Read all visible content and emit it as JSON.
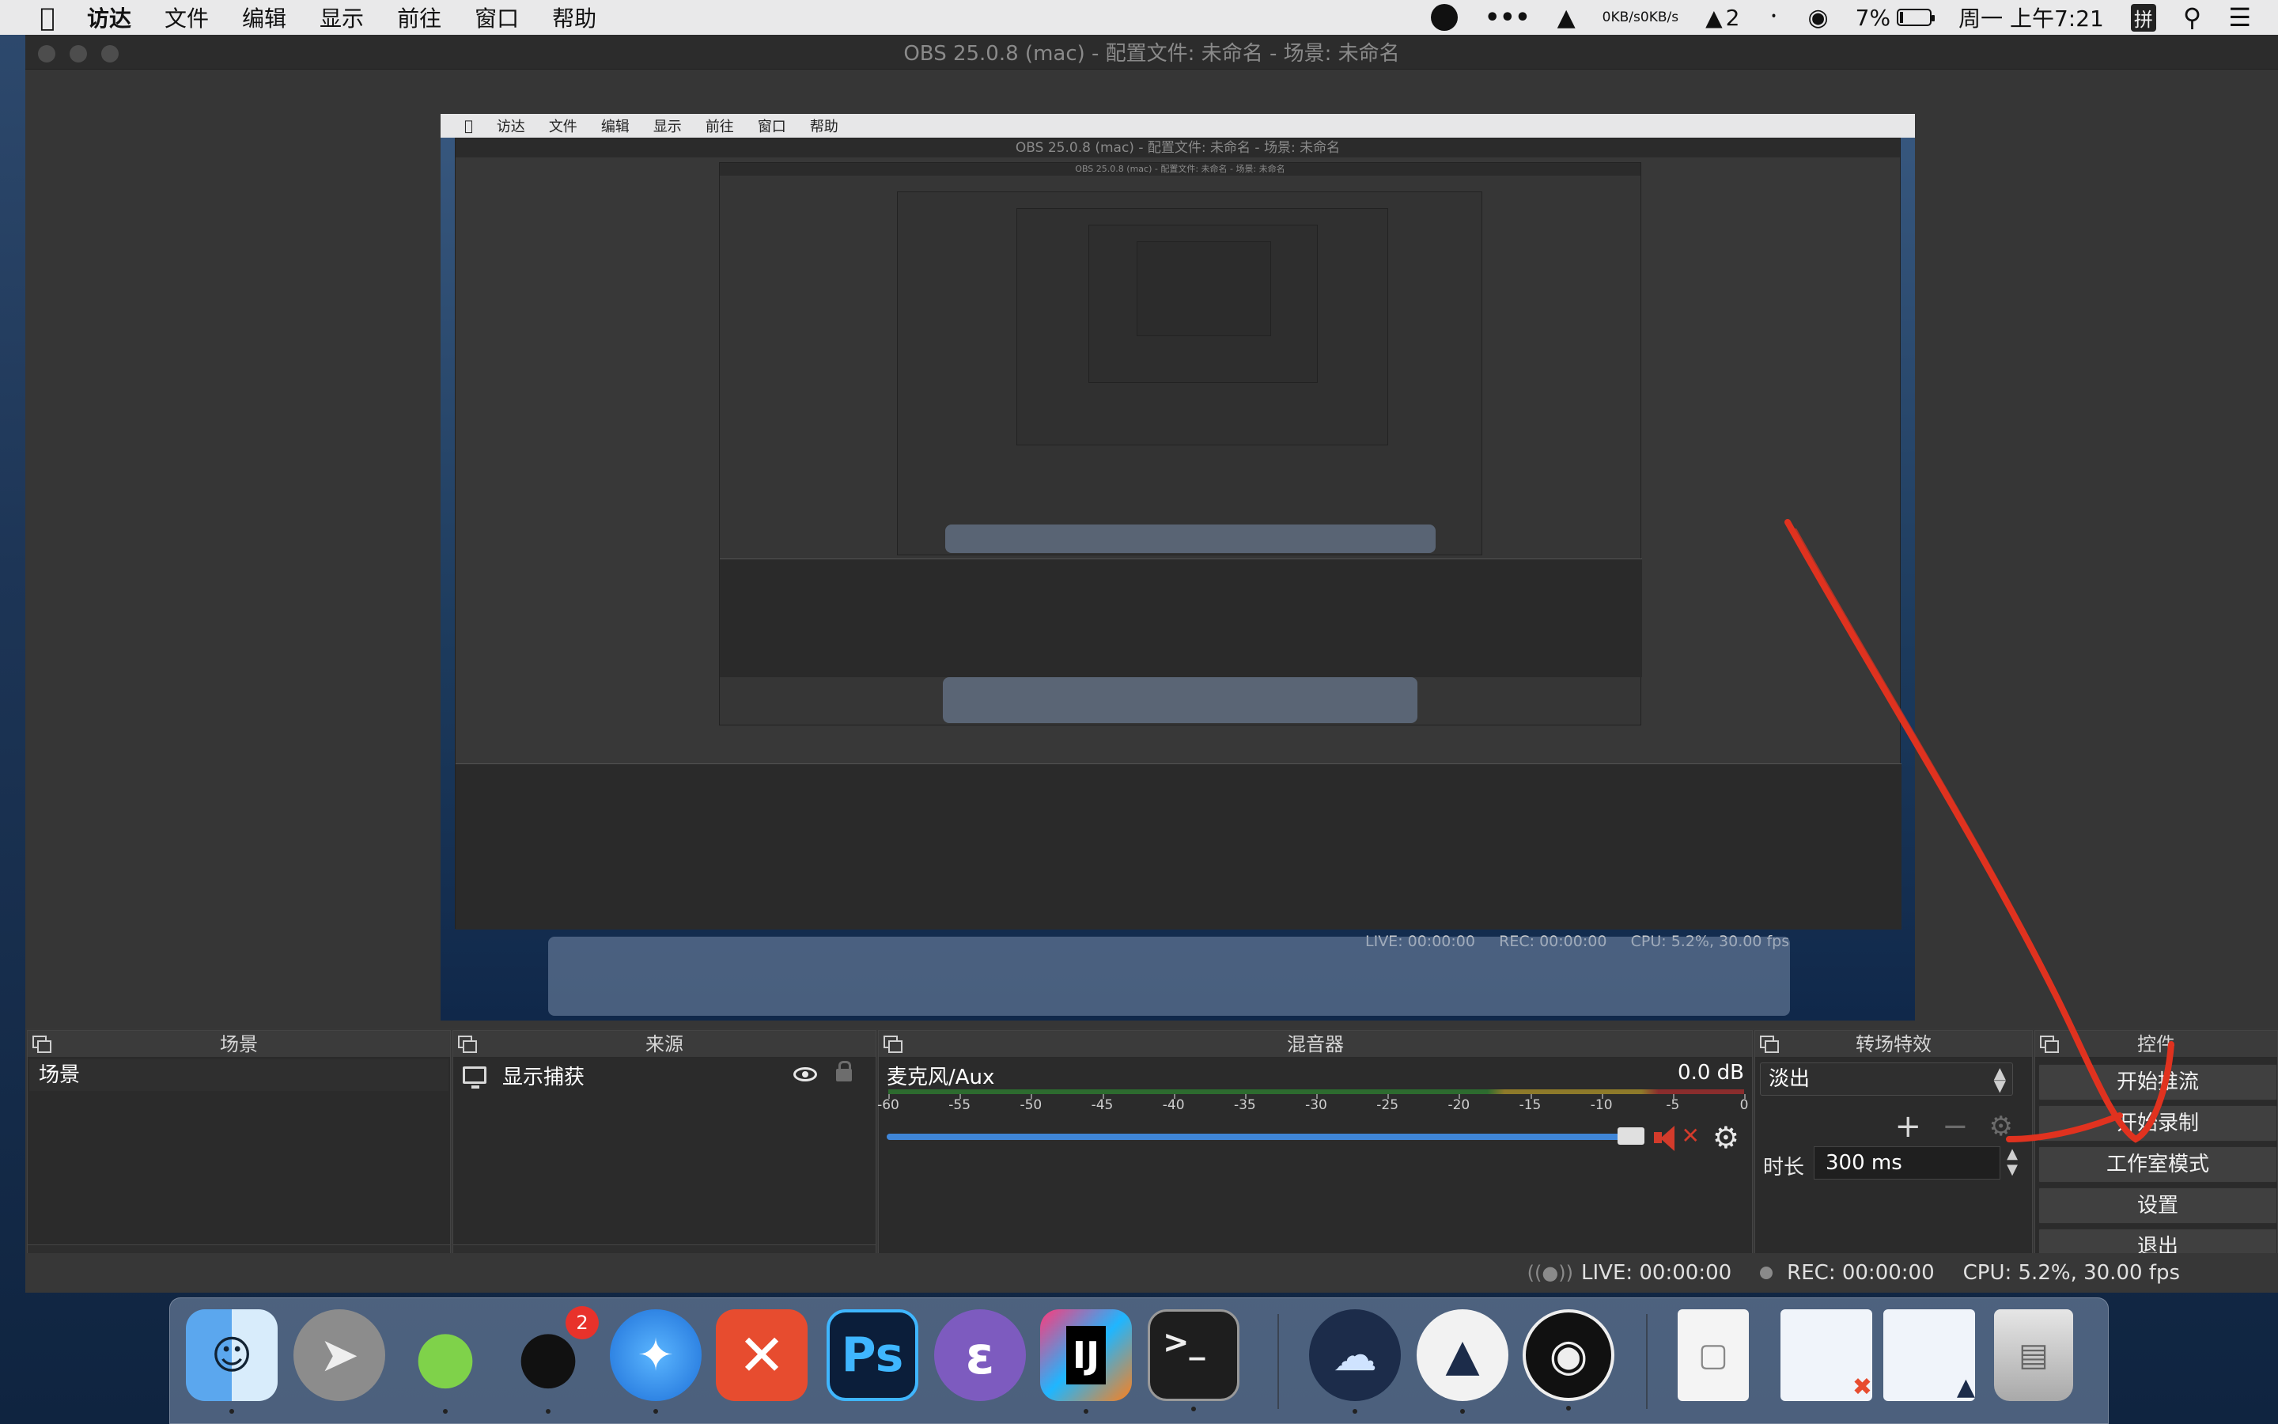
{
  "menubar": {
    "app_name": "访达",
    "items": [
      "文件",
      "编辑",
      "显示",
      "前往",
      "窗口",
      "帮助"
    ],
    "net_up": "0KB/s",
    "net_down": "0KB/s",
    "qq_count": "2",
    "battery": "7%",
    "datetime": "周一 上午7:21",
    "input_method": "拼"
  },
  "window": {
    "title": "OBS 25.0.8 (mac) - 配置文件: 未命名 - 场景: 未命名"
  },
  "nested": {
    "menubar_items": [
      "访达",
      "文件",
      "编辑",
      "显示",
      "前往",
      "窗口",
      "帮助"
    ],
    "status_live": "LIVE: 00:00:00",
    "status_rec": "REC: 00:00:00",
    "status_cpu": "CPU: 5.2%, 30.00 fps"
  },
  "scenes": {
    "header": "场景",
    "items": [
      "场景"
    ]
  },
  "sources": {
    "header": "来源",
    "items": [
      "显示捕获"
    ]
  },
  "mixer": {
    "header": "混音器",
    "channel_name": "麦克风/Aux",
    "db_value": "0.0 dB",
    "ticks": [
      "-60",
      "-55",
      "-50",
      "-45",
      "-40",
      "-35",
      "-30",
      "-25",
      "-20",
      "-15",
      "-10",
      "-5",
      "0"
    ],
    "volume_level": 1.0,
    "muted": true
  },
  "transitions": {
    "header": "转场特效",
    "selected": "淡出",
    "duration_label": "时长",
    "duration_value": "300 ms"
  },
  "controls": {
    "header": "控件",
    "start_stream": "开始推流",
    "start_record": "开始录制",
    "studio_mode": "工作室模式",
    "settings": "设置",
    "exit": "退出"
  },
  "statusbar": {
    "live": "LIVE: 00:00:00",
    "rec": "REC: 00:00:00",
    "cpu": "CPU: 5.2%, 30.00 fps"
  },
  "dock": {
    "qq_badge": "2",
    "ps_label": "Ps",
    "ij_label": "IJ",
    "terminal_label": ">_"
  },
  "colors": {
    "accent_blue": "#3f86d8",
    "mute_red": "#d33b2b",
    "annotation_red": "#e0321f"
  }
}
